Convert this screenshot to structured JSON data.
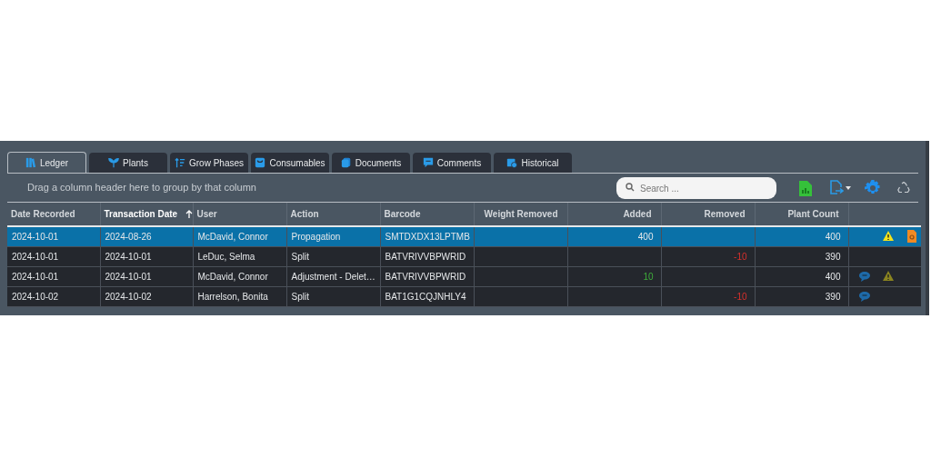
{
  "tabs": [
    {
      "label": "Ledger",
      "selected": true
    },
    {
      "label": "Plants",
      "selected": false
    },
    {
      "label": "Grow Phases",
      "selected": false
    },
    {
      "label": "Consumables",
      "selected": false
    },
    {
      "label": "Documents",
      "selected": false
    },
    {
      "label": "Comments",
      "selected": false
    },
    {
      "label": "Historical",
      "selected": false
    }
  ],
  "group_panel": "Drag a column header here to group by that column",
  "search": {
    "placeholder": "Search ..."
  },
  "table": {
    "columns": [
      {
        "label": "Date Recorded",
        "sorted_ascending": false
      },
      {
        "label": "Transaction Date",
        "sorted_ascending": true
      },
      {
        "label": "User",
        "sorted_ascending": false
      },
      {
        "label": "Action",
        "sorted_ascending": false
      },
      {
        "label": "Barcode",
        "sorted_ascending": false
      },
      {
        "label": "Weight Removed",
        "sorted_ascending": false
      },
      {
        "label": "Added",
        "sorted_ascending": false
      },
      {
        "label": "Removed",
        "sorted_ascending": false
      },
      {
        "label": "Plant Count",
        "sorted_ascending": false
      }
    ],
    "rows": [
      {
        "selected": true,
        "cells": [
          "2024-10-01",
          "2024-08-26",
          "McDavid, Connor",
          "Propagation",
          "SMTDXDX13LPTMB",
          "",
          "400",
          "",
          "400"
        ],
        "flags": [
          {
            "kind": "warning"
          },
          {
            "kind": "document"
          }
        ]
      },
      {
        "selected": false,
        "cells": [
          "2024-10-01",
          "2024-10-01",
          "LeDuc, Selma",
          "Split",
          "BATVRIVVBPWRID",
          "",
          "",
          "-10",
          "390"
        ],
        "flags": []
      },
      {
        "selected": false,
        "cells": [
          "2024-10-01",
          "2024-10-01",
          "McDavid, Connor",
          "Adjustment - Delet…",
          "BATVRIVVBPWRID",
          "",
          "10",
          "",
          "400"
        ],
        "flags": [
          {
            "kind": "comment"
          },
          {
            "kind": "warning"
          }
        ]
      },
      {
        "selected": false,
        "cells": [
          "2024-10-02",
          "2024-10-02",
          "Harrelson, Bonita",
          "Split",
          "BAT1G1CQJNHLY4",
          "",
          "",
          "-10",
          "390"
        ],
        "flags": [
          {
            "kind": "comment"
          }
        ]
      }
    ]
  }
}
